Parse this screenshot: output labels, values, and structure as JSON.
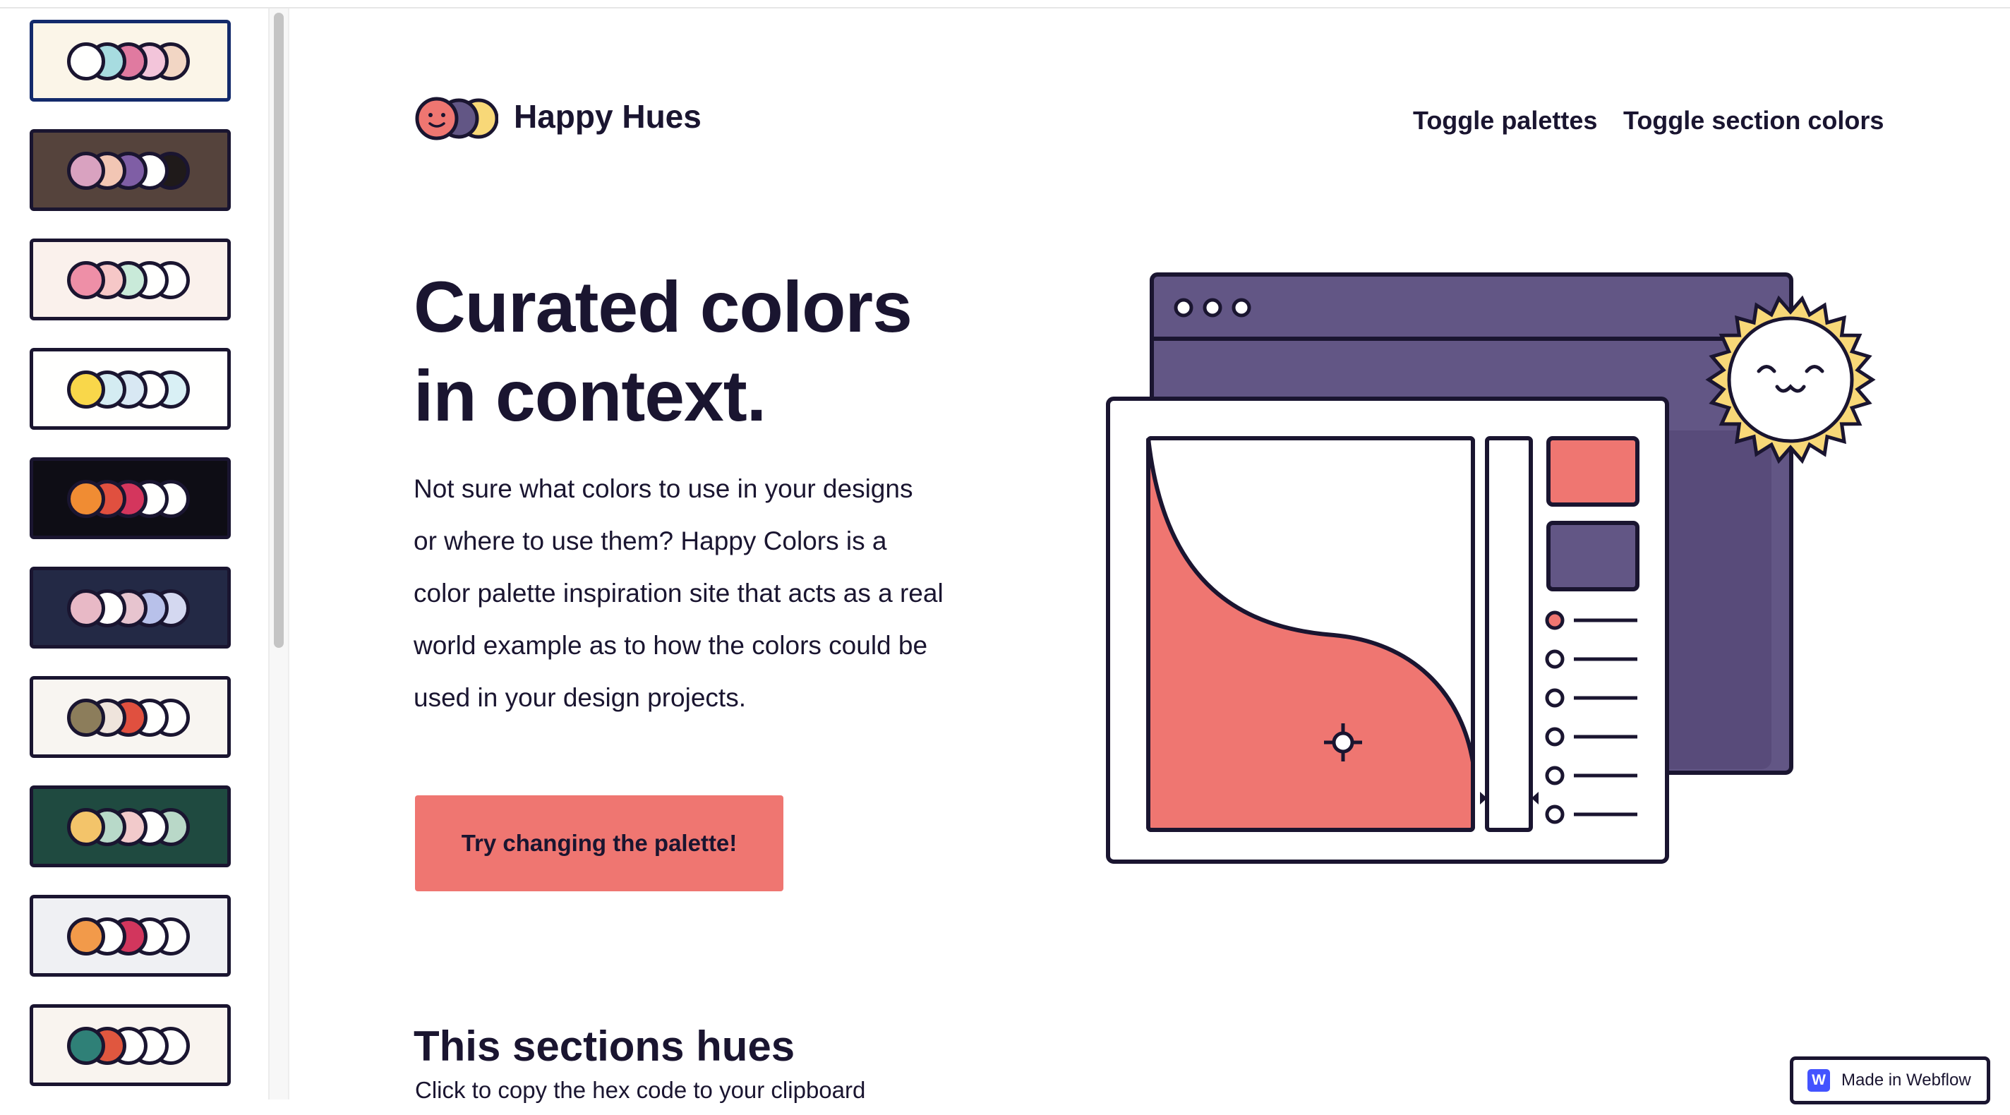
{
  "brand": {
    "name": "Happy Hues"
  },
  "nav": {
    "toggle_palettes": "Toggle palettes",
    "toggle_section_colors": "Toggle section colors"
  },
  "hero": {
    "title_line1": "Curated colors",
    "title_line2": "in context.",
    "text_lines": [
      "Not sure what colors to use in your designs",
      "or where to use them? Happy Colors is a",
      "color palette inspiration site that acts as a real",
      "world example as to how the colors could be",
      "used in your design projects."
    ],
    "cta_label": "Try changing the palette!"
  },
  "section": {
    "title": "This sections hues",
    "subtitle": "Click to copy the hex code to your clipboard"
  },
  "badge": {
    "logo_letter": "W",
    "label": "Made in Webflow"
  },
  "colors": {
    "primary_text": "#1a1530",
    "button": "#ef7671",
    "illustration_purple": "#625685",
    "sun_yellow": "#f8d878",
    "webflow_blue": "#4353ff"
  },
  "palettes": [
    {
      "bg": "#fbf5e8",
      "dots": [
        "#fffffe",
        "#a7dce0",
        "#e07aa0",
        "#f3c5da",
        "#f2d6c4"
      ],
      "selected": true
    },
    {
      "bg": "#55433c",
      "dots": [
        "#d9a2c0",
        "#f2c6b4",
        "#7f5ea5",
        "#fffffe",
        "#1f1a1a"
      ]
    },
    {
      "bg": "#faf1ec",
      "dots": [
        "#ee8fa7",
        "#f6c7c7",
        "#c9ead9",
        "#fffffe",
        "#fffffe"
      ]
    },
    {
      "bg": "#fffffe",
      "dots": [
        "#f9d74a",
        "#d4ecf2",
        "#d8e8f3",
        "#fffffe",
        "#d9f0f5"
      ]
    },
    {
      "bg": "#0e0d15",
      "dots": [
        "#f08c33",
        "#e0503f",
        "#d4365d",
        "#fffffe",
        "#fffffe"
      ]
    },
    {
      "bg": "#232945",
      "dots": [
        "#e8b9c6",
        "#fffffe",
        "#e7c4cf",
        "#b8c1ea",
        "#d4d8f0"
      ]
    },
    {
      "bg": "#f8f5f1",
      "dots": [
        "#8c7d5b",
        "#efe4dc",
        "#e0503f",
        "#fffffe",
        "#fffffe"
      ]
    },
    {
      "bg": "#1f4a40",
      "dots": [
        "#f3c46a",
        "#b8d9c9",
        "#f2cacb",
        "#fffffe",
        "#b9d8c8"
      ]
    },
    {
      "bg": "#eff0f3",
      "dots": [
        "#f29a4a",
        "#fffffe",
        "#d2365d",
        "#fffffe",
        "#fffffe"
      ]
    },
    {
      "bg": "#f9f4ef",
      "dots": [
        "#2f8077",
        "#e0573f",
        "#fffffe",
        "#fffffe",
        "#fffffe"
      ]
    }
  ]
}
